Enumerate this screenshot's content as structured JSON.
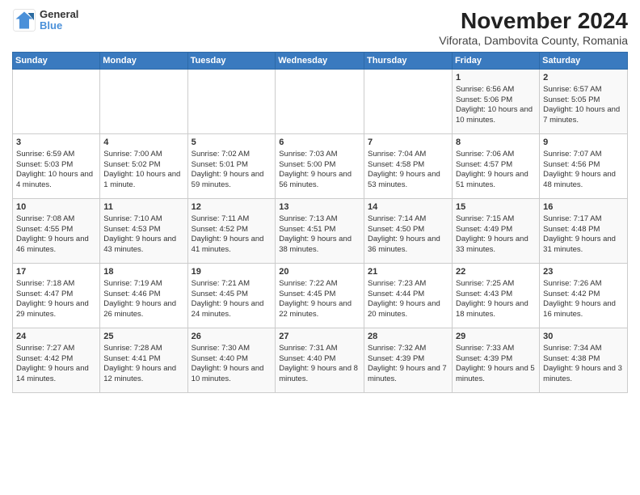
{
  "logo": {
    "line1": "General",
    "line2": "Blue"
  },
  "title": "November 2024",
  "subtitle": "Viforata, Dambovita County, Romania",
  "days_of_week": [
    "Sunday",
    "Monday",
    "Tuesday",
    "Wednesday",
    "Thursday",
    "Friday",
    "Saturday"
  ],
  "weeks": [
    [
      {
        "day": "",
        "info": ""
      },
      {
        "day": "",
        "info": ""
      },
      {
        "day": "",
        "info": ""
      },
      {
        "day": "",
        "info": ""
      },
      {
        "day": "",
        "info": ""
      },
      {
        "day": "1",
        "info": "Sunrise: 6:56 AM\nSunset: 5:06 PM\nDaylight: 10 hours and 10 minutes."
      },
      {
        "day": "2",
        "info": "Sunrise: 6:57 AM\nSunset: 5:05 PM\nDaylight: 10 hours and 7 minutes."
      }
    ],
    [
      {
        "day": "3",
        "info": "Sunrise: 6:59 AM\nSunset: 5:03 PM\nDaylight: 10 hours and 4 minutes."
      },
      {
        "day": "4",
        "info": "Sunrise: 7:00 AM\nSunset: 5:02 PM\nDaylight: 10 hours and 1 minute."
      },
      {
        "day": "5",
        "info": "Sunrise: 7:02 AM\nSunset: 5:01 PM\nDaylight: 9 hours and 59 minutes."
      },
      {
        "day": "6",
        "info": "Sunrise: 7:03 AM\nSunset: 5:00 PM\nDaylight: 9 hours and 56 minutes."
      },
      {
        "day": "7",
        "info": "Sunrise: 7:04 AM\nSunset: 4:58 PM\nDaylight: 9 hours and 53 minutes."
      },
      {
        "day": "8",
        "info": "Sunrise: 7:06 AM\nSunset: 4:57 PM\nDaylight: 9 hours and 51 minutes."
      },
      {
        "day": "9",
        "info": "Sunrise: 7:07 AM\nSunset: 4:56 PM\nDaylight: 9 hours and 48 minutes."
      }
    ],
    [
      {
        "day": "10",
        "info": "Sunrise: 7:08 AM\nSunset: 4:55 PM\nDaylight: 9 hours and 46 minutes."
      },
      {
        "day": "11",
        "info": "Sunrise: 7:10 AM\nSunset: 4:53 PM\nDaylight: 9 hours and 43 minutes."
      },
      {
        "day": "12",
        "info": "Sunrise: 7:11 AM\nSunset: 4:52 PM\nDaylight: 9 hours and 41 minutes."
      },
      {
        "day": "13",
        "info": "Sunrise: 7:13 AM\nSunset: 4:51 PM\nDaylight: 9 hours and 38 minutes."
      },
      {
        "day": "14",
        "info": "Sunrise: 7:14 AM\nSunset: 4:50 PM\nDaylight: 9 hours and 36 minutes."
      },
      {
        "day": "15",
        "info": "Sunrise: 7:15 AM\nSunset: 4:49 PM\nDaylight: 9 hours and 33 minutes."
      },
      {
        "day": "16",
        "info": "Sunrise: 7:17 AM\nSunset: 4:48 PM\nDaylight: 9 hours and 31 minutes."
      }
    ],
    [
      {
        "day": "17",
        "info": "Sunrise: 7:18 AM\nSunset: 4:47 PM\nDaylight: 9 hours and 29 minutes."
      },
      {
        "day": "18",
        "info": "Sunrise: 7:19 AM\nSunset: 4:46 PM\nDaylight: 9 hours and 26 minutes."
      },
      {
        "day": "19",
        "info": "Sunrise: 7:21 AM\nSunset: 4:45 PM\nDaylight: 9 hours and 24 minutes."
      },
      {
        "day": "20",
        "info": "Sunrise: 7:22 AM\nSunset: 4:45 PM\nDaylight: 9 hours and 22 minutes."
      },
      {
        "day": "21",
        "info": "Sunrise: 7:23 AM\nSunset: 4:44 PM\nDaylight: 9 hours and 20 minutes."
      },
      {
        "day": "22",
        "info": "Sunrise: 7:25 AM\nSunset: 4:43 PM\nDaylight: 9 hours and 18 minutes."
      },
      {
        "day": "23",
        "info": "Sunrise: 7:26 AM\nSunset: 4:42 PM\nDaylight: 9 hours and 16 minutes."
      }
    ],
    [
      {
        "day": "24",
        "info": "Sunrise: 7:27 AM\nSunset: 4:42 PM\nDaylight: 9 hours and 14 minutes."
      },
      {
        "day": "25",
        "info": "Sunrise: 7:28 AM\nSunset: 4:41 PM\nDaylight: 9 hours and 12 minutes."
      },
      {
        "day": "26",
        "info": "Sunrise: 7:30 AM\nSunset: 4:40 PM\nDaylight: 9 hours and 10 minutes."
      },
      {
        "day": "27",
        "info": "Sunrise: 7:31 AM\nSunset: 4:40 PM\nDaylight: 9 hours and 8 minutes."
      },
      {
        "day": "28",
        "info": "Sunrise: 7:32 AM\nSunset: 4:39 PM\nDaylight: 9 hours and 7 minutes."
      },
      {
        "day": "29",
        "info": "Sunrise: 7:33 AM\nSunset: 4:39 PM\nDaylight: 9 hours and 5 minutes."
      },
      {
        "day": "30",
        "info": "Sunrise: 7:34 AM\nSunset: 4:38 PM\nDaylight: 9 hours and 3 minutes."
      }
    ]
  ]
}
